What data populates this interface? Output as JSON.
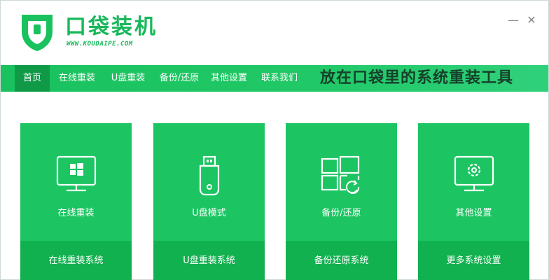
{
  "app": {
    "title": "口袋装机",
    "url": "WWW.KOUDAIPE.COM",
    "accent_color": "#1cc562",
    "logo_icon": "shield-icon"
  },
  "window_controls": {
    "minimize": "—",
    "close": "✕"
  },
  "nav": {
    "items": [
      {
        "label": "首页",
        "active": true
      },
      {
        "label": "在线重装",
        "active": false
      },
      {
        "label": "U盘重装",
        "active": false
      },
      {
        "label": "备份/还原",
        "active": false
      },
      {
        "label": "其他设置",
        "active": false
      },
      {
        "label": "联系我们",
        "active": false
      }
    ],
    "slogan": "放在口袋里的系统重装工具"
  },
  "cards": [
    {
      "icon": "monitor-windows-icon",
      "title": "在线重装",
      "action": "在线重装系统"
    },
    {
      "icon": "usb-drive-icon",
      "title": "U盘模式",
      "action": "U盘重装系统"
    },
    {
      "icon": "windows-restore-icon",
      "title": "备份/还原",
      "action": "备份还原系统"
    },
    {
      "icon": "monitor-gear-icon",
      "title": "其他设置",
      "action": "更多系统设置"
    }
  ]
}
